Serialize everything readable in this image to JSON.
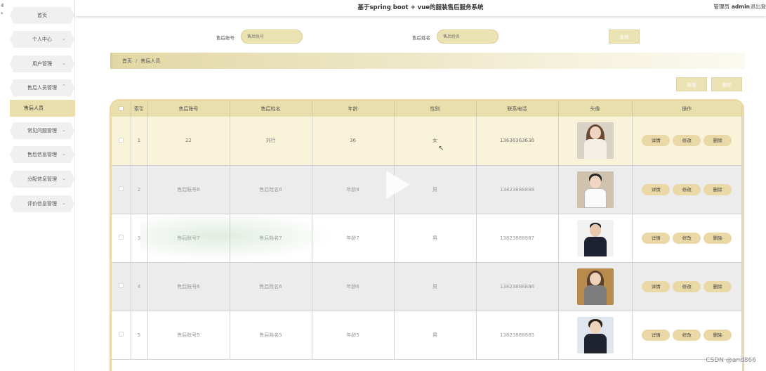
{
  "header": {
    "title": "基于spring boot + vue的服装售后服务系统",
    "user_label": "管理员",
    "username": "admin",
    "logout": "退出登"
  },
  "sidebar": {
    "items": [
      {
        "label": "首页"
      },
      {
        "label": "个人中心"
      },
      {
        "label": "用户管理"
      },
      {
        "label": "售后人员管理"
      },
      {
        "label": "售后人员"
      },
      {
        "label": "常见问题管理"
      },
      {
        "label": "售后信息管理"
      },
      {
        "label": "分配信息管理"
      },
      {
        "label": "评价信息管理"
      }
    ]
  },
  "search": {
    "account_label": "售后账号",
    "account_placeholder": "售后账号",
    "name_label": "售后姓名",
    "name_placeholder": "售后姓名",
    "query_button": "查询"
  },
  "breadcrumb": {
    "home": "首页",
    "current": "售后人员"
  },
  "actions": {
    "add": "新增",
    "delete": "删除"
  },
  "table": {
    "columns": [
      "索引",
      "售后账号",
      "售后姓名",
      "年龄",
      "性别",
      "联系电话",
      "头像",
      "操作"
    ],
    "rows": [
      {
        "index": "1",
        "account": "22",
        "name": "刘行",
        "age": "36",
        "gender": "女",
        "phone": "13636363636"
      },
      {
        "index": "2",
        "account": "售后账号8",
        "name": "售后姓名8",
        "age": "年龄8",
        "gender": "男",
        "phone": "13823888888"
      },
      {
        "index": "3",
        "account": "售后账号7",
        "name": "售后姓名7",
        "age": "年龄7",
        "gender": "男",
        "phone": "13823888887"
      },
      {
        "index": "4",
        "account": "售后账号6",
        "name": "售后姓名6",
        "age": "年龄6",
        "gender": "男",
        "phone": "13823888886"
      },
      {
        "index": "5",
        "account": "售后账号5",
        "name": "售后姓名5",
        "age": "年龄5",
        "gender": "男",
        "phone": "13823888885"
      }
    ],
    "op_labels": {
      "detail": "详情",
      "edit": "修改",
      "delete": "删除"
    }
  },
  "watermark": "CSDN @and866",
  "colors": {
    "accent": "#e9dfac",
    "accent_border": "#ead9a6",
    "highlight_row": "#f8f3d9"
  }
}
